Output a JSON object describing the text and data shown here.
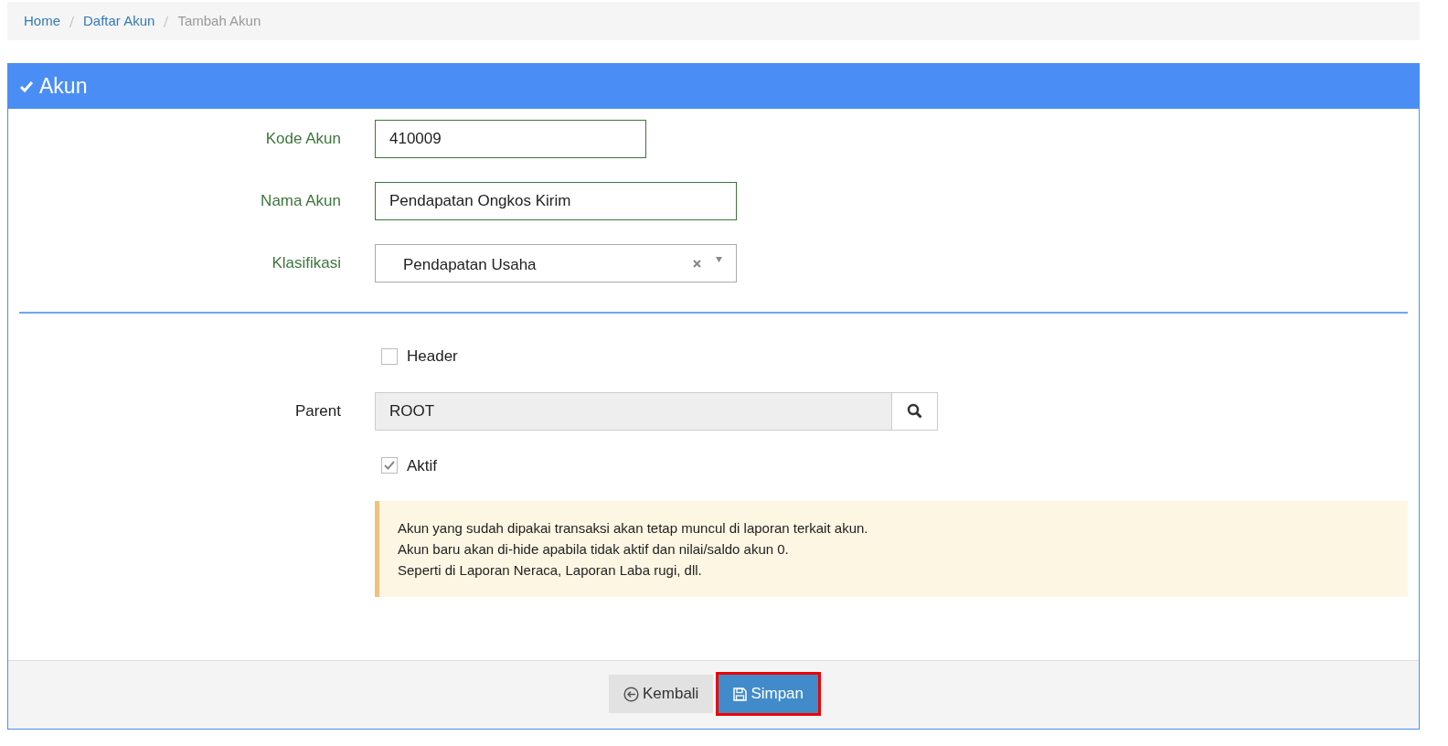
{
  "breadcrumb": [
    {
      "label": "Home",
      "active": false
    },
    {
      "label": "Daftar Akun",
      "active": false
    },
    {
      "label": "Tambah Akun",
      "active": true
    }
  ],
  "panel": {
    "title": "Akun"
  },
  "fields": [
    {
      "kind": "text",
      "label": "Kode Akun",
      "value": "410009",
      "valid": true
    },
    {
      "kind": "text",
      "label": "Nama Akun",
      "value": "Pendapatan Ongkos Kirim",
      "valid": true
    },
    {
      "kind": "select",
      "label": "Klasifikasi",
      "value": "Pendapatan Usaha",
      "valid": true
    }
  ],
  "options": [
    {
      "kind": "checkbox",
      "label": "Header",
      "checked": false
    },
    {
      "kind": "lookup",
      "label": "Parent",
      "value": "ROOT",
      "readonly": true
    },
    {
      "kind": "checkbox",
      "label": "Aktif",
      "checked": true
    }
  ],
  "notice": [
    "Akun yang sudah dipakai transaksi akan tetap muncul di laporan terkait akun.",
    "Akun baru akan di-hide apabila tidak aktif dan nilai/saldo akun 0.",
    "Seperti di Laporan Neraca, Laporan Laba rugi, dll."
  ],
  "buttons": [
    {
      "kind": "back",
      "label": "Kembali",
      "highlighted": false
    },
    {
      "kind": "save",
      "label": "Simpan",
      "highlighted": true
    }
  ]
}
